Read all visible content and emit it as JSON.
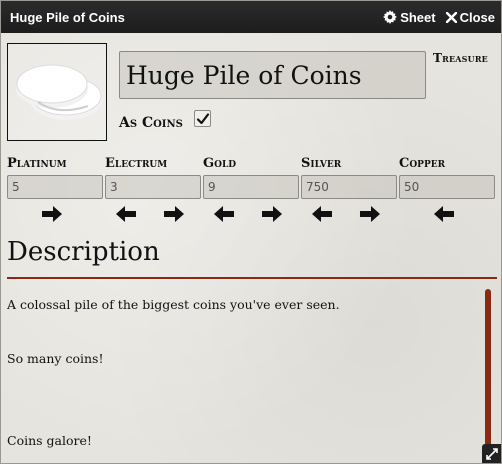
{
  "window": {
    "title": "Huge Pile of Coins",
    "sheet_label": "Sheet",
    "close_label": "Close"
  },
  "item": {
    "name": "Huge Pile of Coins",
    "type": "Treasure",
    "as_coins_label": "As Coins",
    "as_coins_checked": true
  },
  "coins": [
    {
      "label": "Platinum",
      "value": "5"
    },
    {
      "label": "Electrum",
      "value": "3"
    },
    {
      "label": "Gold",
      "value": "9"
    },
    {
      "label": "Silver",
      "value": "750"
    },
    {
      "label": "Copper",
      "value": "50"
    }
  ],
  "description": {
    "heading": "Description",
    "paragraphs": [
      "A colossal pile of the biggest coins you've ever seen.",
      "So many coins!",
      "Coins galore!"
    ]
  },
  "icons": {
    "sheet": "gear-icon",
    "close": "close-icon",
    "arrows": [
      "arrow-right-icon",
      "arrow-left-icon",
      "arrow-right-icon",
      "arrow-left-icon",
      "arrow-right-icon",
      "arrow-left-icon",
      "arrow-right-icon",
      "arrow-left-icon"
    ],
    "resize": "resize-icon"
  },
  "colors": {
    "accent": "#8b2a13",
    "titlebar": "#222222"
  }
}
